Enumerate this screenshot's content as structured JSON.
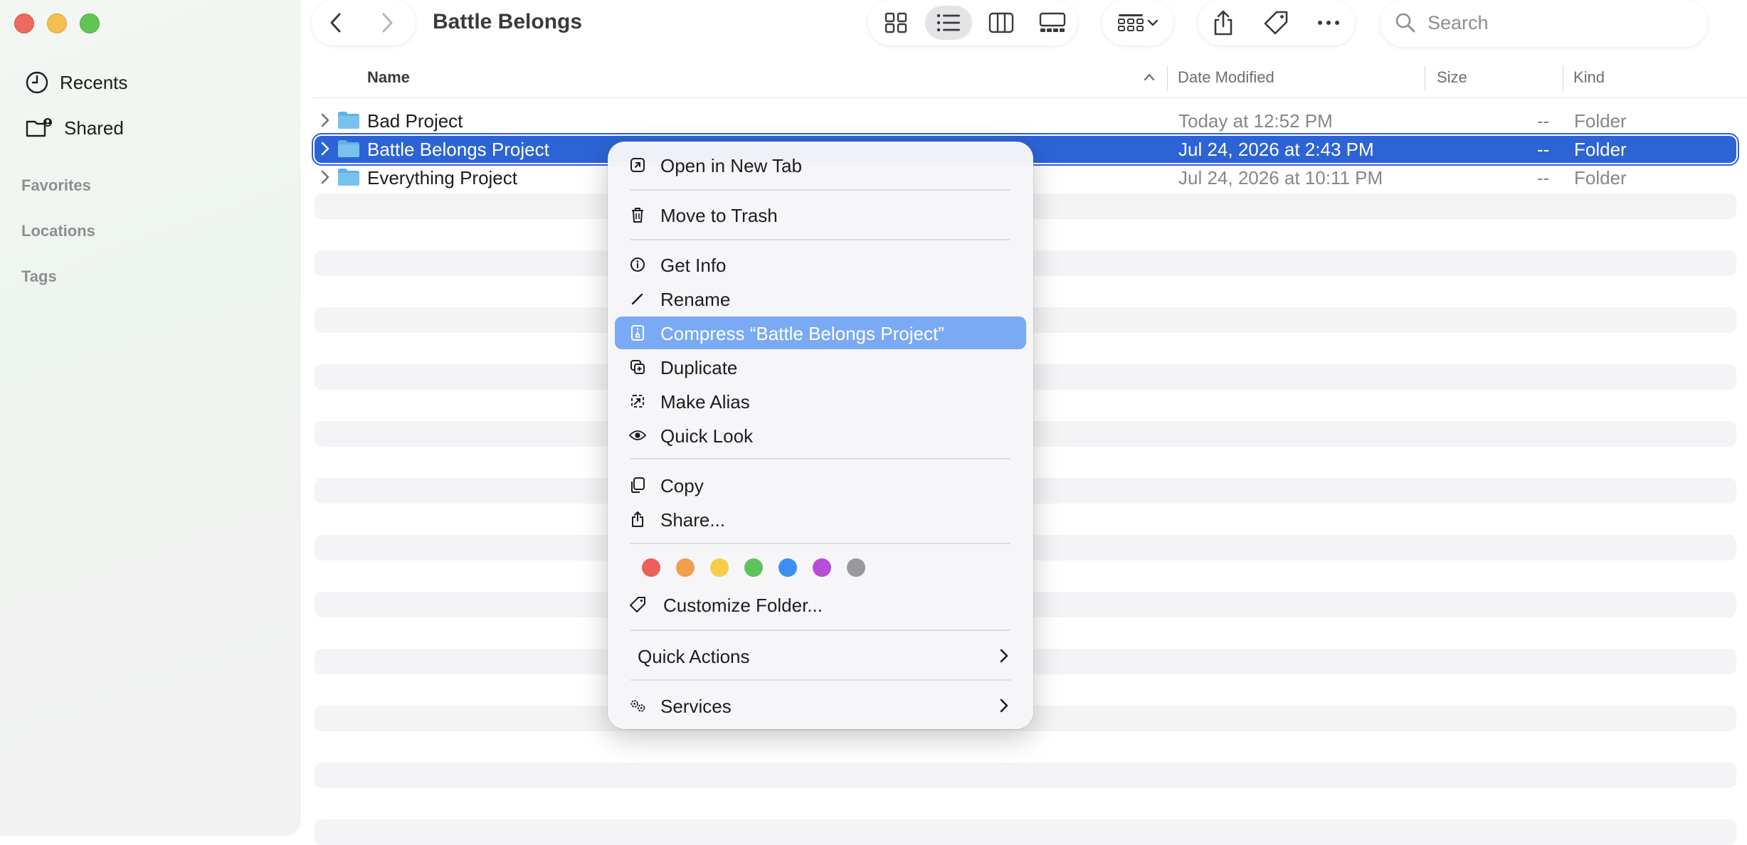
{
  "window": {
    "title": "Battle Belongs"
  },
  "sidebar": {
    "items": [
      {
        "label": "Recents",
        "icon": "clock-icon"
      },
      {
        "label": "Shared",
        "icon": "shared-folder-icon"
      }
    ],
    "sections": [
      "Favorites",
      "Locations",
      "Tags"
    ]
  },
  "toolbar": {
    "view_modes": [
      "icon-view",
      "list-view",
      "column-view",
      "gallery-view"
    ],
    "active_view": "list-view",
    "search_placeholder": "Search"
  },
  "table": {
    "headers": {
      "name": "Name",
      "date": "Date Modified",
      "size": "Size",
      "kind": "Kind"
    },
    "rows": [
      {
        "name": "Bad Project",
        "date": "Today at 12:52 PM",
        "size": "--",
        "kind": "Folder",
        "selected": false
      },
      {
        "name": "Battle Belongs Project",
        "date": "Jul 24, 2026 at 2:43 PM",
        "size": "--",
        "kind": "Folder",
        "selected": true
      },
      {
        "name": "Everything Project",
        "date": "Jul 24, 2026 at 10:11 PM",
        "size": "--",
        "kind": "Folder",
        "selected": false
      }
    ]
  },
  "context_menu": {
    "open_new_tab": "Open in New Tab",
    "move_to_trash": "Move to Trash",
    "get_info": "Get Info",
    "rename": "Rename",
    "compress": "Compress “Battle Belongs Project”",
    "duplicate": "Duplicate",
    "make_alias": "Make Alias",
    "quick_look": "Quick Look",
    "copy": "Copy",
    "share": "Share...",
    "customize_folder": "Customize Folder...",
    "quick_actions": "Quick Actions",
    "services": "Services",
    "highlighted": "compress",
    "tag_colors": [
      "#ec5f5b",
      "#f29e4c",
      "#f6cc48",
      "#5fc35c",
      "#3b8ff0",
      "#b84ed8",
      "#98989d"
    ]
  },
  "colors": {
    "selection": "#2c64d5",
    "menu_highlight": "#7aaaf4",
    "folder": "#5fb3ea"
  }
}
